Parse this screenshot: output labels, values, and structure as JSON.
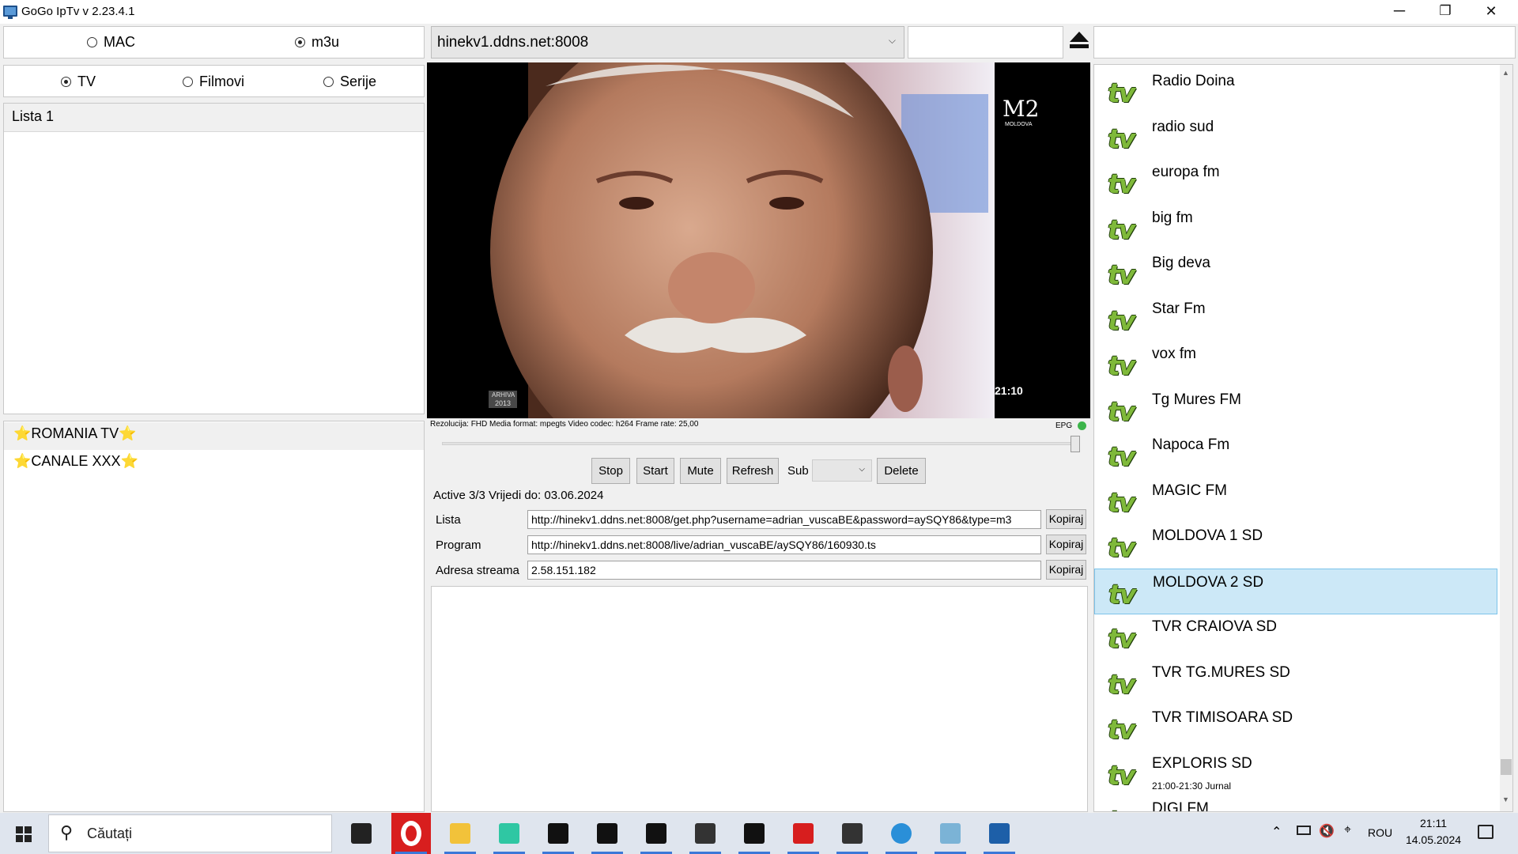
{
  "window": {
    "title": "GoGo IpTv v 2.23.4.1",
    "minimize": "─",
    "restore": "❐",
    "close": "✕"
  },
  "source_mode": {
    "options": [
      "MAC",
      "m3u"
    ],
    "selected": "m3u"
  },
  "content_type": {
    "options": [
      "TV",
      "Filmovi",
      "Serije"
    ],
    "selected": "TV"
  },
  "playlists": {
    "header": "Lista 1"
  },
  "categories": [
    "⭐ROMANIA TV⭐",
    "⭐CANALE XXX⭐"
  ],
  "server": {
    "selected": "hinekv1.ddns.net:8008",
    "extra_field": "",
    "eject_icon": "eject-icon",
    "search_value": ""
  },
  "video": {
    "channel_logo": "M2",
    "channel_logo_sub": "MOLDOVA",
    "archive_badge_top": "ARHIVA",
    "archive_badge_bottom": "2013",
    "clock": "21:10"
  },
  "info_line": "Rezolucija: FHD Media format: mpegts Video codec: h264 Frame rate: 25,00",
  "epg_label": "EPG",
  "epg_status_color": "#3cb44a",
  "volume_slider_value": 1.0,
  "controls": {
    "stop": "Stop",
    "start": "Start",
    "mute": "Mute",
    "refresh": "Refresh",
    "sub_label": "Sub",
    "sub_value": "",
    "delete": "Delete"
  },
  "account_status": "Active 3/3 Vrijedi do: 03.06.2024",
  "fields": [
    {
      "label": "Lista",
      "value": "http://hinekv1.ddns.net:8008/get.php?username=adrian_vuscaBE&password=aySQY86&type=m3",
      "button": "Kopiraj"
    },
    {
      "label": "Program",
      "value": "http://hinekv1.ddns.net:8008/live/adrian_vuscaBE/aySQY86/160930.ts",
      "button": "Kopiraj"
    },
    {
      "label": "Adresa streama",
      "value": "2.58.151.182",
      "button": "Kopiraj"
    }
  ],
  "channels": [
    {
      "name": "Radio Doina",
      "sub": ""
    },
    {
      "name": "radio sud",
      "sub": ""
    },
    {
      "name": "europa fm",
      "sub": ""
    },
    {
      "name": "big fm",
      "sub": ""
    },
    {
      "name": "Big deva",
      "sub": ""
    },
    {
      "name": "Star Fm",
      "sub": ""
    },
    {
      "name": "vox fm",
      "sub": ""
    },
    {
      "name": "Tg Mures FM",
      "sub": ""
    },
    {
      "name": "Napoca Fm",
      "sub": ""
    },
    {
      "name": "MAGIC FM",
      "sub": ""
    },
    {
      "name": "MOLDOVA 1 SD",
      "sub": ""
    },
    {
      "name": "MOLDOVA 2 SD",
      "sub": "",
      "selected": true
    },
    {
      "name": "TVR CRAIOVA SD",
      "sub": ""
    },
    {
      "name": "TVR TG.MURES SD",
      "sub": ""
    },
    {
      "name": "TVR TIMISOARA SD",
      "sub": ""
    },
    {
      "name": "EXPLORIS SD",
      "sub": "21:00-21:30 Jurnal"
    },
    {
      "name": "DIGI FM",
      "sub": ""
    }
  ],
  "channel_logo_text": "tv",
  "taskbar": {
    "search_placeholder": "Căutați",
    "tray_language": "ROU",
    "time": "21:11",
    "date": "14.05.2024",
    "apps": [
      "task-view-icon",
      "opera-icon",
      "file-explorer-icon",
      "snip-tool-icon",
      "spy-icon",
      "spy-icon",
      "spy-icon",
      "agent-icon",
      "terminal-icon",
      "media-player-icon",
      "agent-icon",
      "network-globe-icon",
      "notes-icon",
      "monitor-icon"
    ]
  }
}
